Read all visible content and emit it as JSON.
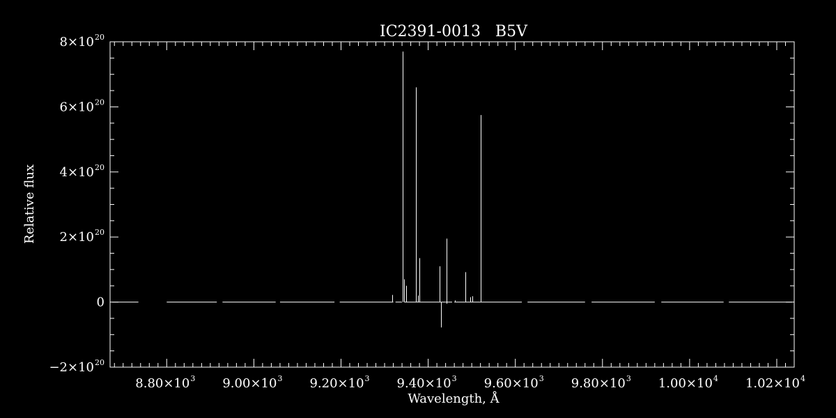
{
  "chart_data": {
    "type": "line",
    "title": "IC2391-0013   B5V",
    "xlabel": "Wavelength, Å",
    "ylabel": "Relative flux",
    "xlim": [
      8670,
      10240
    ],
    "ylim": [
      -2e+20,
      8e+20
    ],
    "x_ticks": [
      {
        "value": 8800,
        "mantissa": "8.80",
        "exp": "3"
      },
      {
        "value": 9000,
        "mantissa": "9.00",
        "exp": "3"
      },
      {
        "value": 9200,
        "mantissa": "9.20",
        "exp": "3"
      },
      {
        "value": 9400,
        "mantissa": "9.40",
        "exp": "3"
      },
      {
        "value": 9600,
        "mantissa": "9.60",
        "exp": "3"
      },
      {
        "value": 9800,
        "mantissa": "9.80",
        "exp": "3"
      },
      {
        "value": 10000,
        "mantissa": "1.00",
        "exp": "4"
      },
      {
        "value": 10200,
        "mantissa": "1.02",
        "exp": "4"
      }
    ],
    "y_ticks": [
      {
        "value": -2e+20,
        "mantissa": "−2",
        "exp": "20"
      },
      {
        "value": 0,
        "mantissa": "0",
        "exp": ""
      },
      {
        "value": 2e+20,
        "mantissa": "2",
        "exp": "20"
      },
      {
        "value": 4e+20,
        "mantissa": "4",
        "exp": "20"
      },
      {
        "value": 6e+20,
        "mantissa": "6",
        "exp": "20"
      },
      {
        "value": 8e+20,
        "mantissa": "8",
        "exp": "20"
      }
    ],
    "baseline_segments": [
      [
        8675,
        8735
      ],
      [
        8800,
        8915
      ],
      [
        8928,
        9050
      ],
      [
        9060,
        9185
      ],
      [
        9197,
        9320
      ],
      [
        9325,
        9340
      ],
      [
        9345,
        9455
      ],
      [
        9460,
        9615
      ],
      [
        9628,
        9760
      ],
      [
        9775,
        9920
      ],
      [
        9935,
        10078
      ],
      [
        10090,
        10235
      ]
    ],
    "spikes": [
      {
        "x": 9318,
        "y": 2.2e+19
      },
      {
        "x": 9342,
        "y": 7.7e+20
      },
      {
        "x": 9345,
        "y": 7e+19
      },
      {
        "x": 9350,
        "y": 5e+19
      },
      {
        "x": 9372,
        "y": 6.6e+20
      },
      {
        "x": 9377,
        "y": 2e+19
      },
      {
        "x": 9380,
        "y": 1.35e+20
      },
      {
        "x": 9427,
        "y": 1.1e+20
      },
      {
        "x": 9429,
        "y": -7.8e+19
      },
      {
        "x": 9442,
        "y": 1.95e+20
      },
      {
        "x": 9443,
        "y": -5e+18
      },
      {
        "x": 9461,
        "y": 5e+18
      },
      {
        "x": 9485,
        "y": 9.2e+19
      },
      {
        "x": 9497,
        "y": 1.5e+19
      },
      {
        "x": 9502,
        "y": 1.8e+19
      },
      {
        "x": 9520,
        "y": 5.75e+20
      }
    ]
  }
}
